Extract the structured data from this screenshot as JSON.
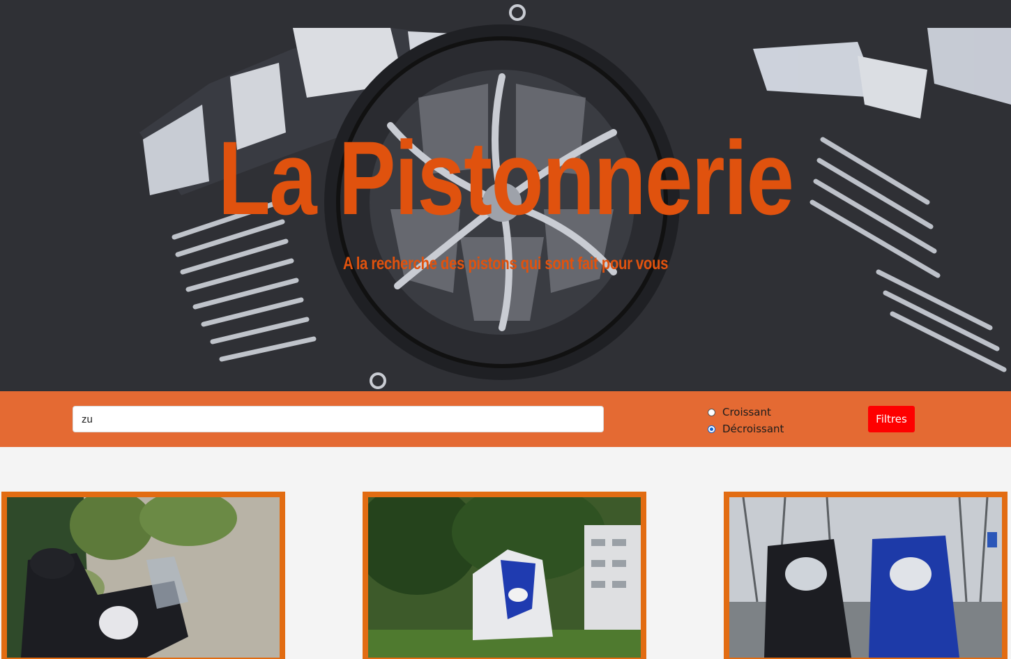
{
  "hero": {
    "title": "La Pistonnerie",
    "subtitle": "A la recherche des pistons qui sont fait pour vous",
    "accent_color": "#e0520e",
    "background": "motorcycle engine close-up"
  },
  "filter": {
    "search_value": "zu",
    "sort_options": [
      {
        "label": "Croissant",
        "checked": false
      },
      {
        "label": "Décroissant",
        "checked": true
      }
    ],
    "button_label": "Filtres",
    "bar_color": "#e46a33",
    "button_color": "#fe0000"
  },
  "cards": [
    {
      "image": "touring motorcycle with luggage by rock wall"
    },
    {
      "image": "blue and white sport bike in front of trees and building"
    },
    {
      "image": "two blue sport bikes front view"
    }
  ]
}
